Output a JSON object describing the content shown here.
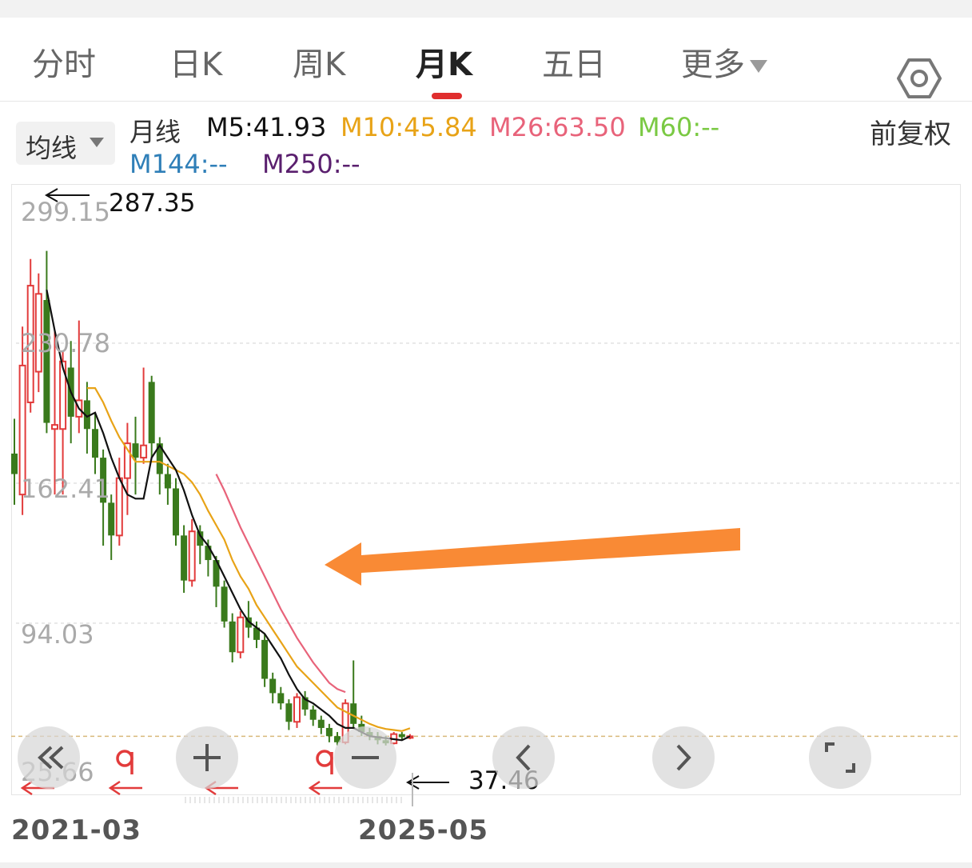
{
  "tabs": [
    {
      "label": "分时"
    },
    {
      "label": "日K"
    },
    {
      "label": "周K"
    },
    {
      "label": "月K"
    },
    {
      "label": "五日"
    },
    {
      "label": "更多"
    }
  ],
  "active_tab": "月K",
  "settings_icon": "hexagon-gear-icon",
  "ma_selector": {
    "label": "均线"
  },
  "legend": {
    "period": "月线",
    "m5": "M5:41.93",
    "m10": "M10:45.84",
    "m26": "M26:63.50",
    "m60": "M60:--",
    "m144": "M144:--",
    "m250": "M250:--"
  },
  "colors": {
    "up": "#e23b3b",
    "down": "#3a7a1c",
    "m5": "#111111",
    "m10": "#e8a317",
    "m26": "#e8637a",
    "m60": "#7ac943",
    "m144": "#2f7fb8",
    "m250": "#5a1f6e",
    "arrow": "#f98a35"
  },
  "adjust_label": "前复权",
  "y_axis_labels": [
    "299.15",
    "230.78",
    "162.41",
    "94.03",
    "25.66"
  ],
  "annotations": {
    "high": "287.35",
    "low": "37.46"
  },
  "date_labels": {
    "start": "2021-03",
    "end": "2025-05"
  },
  "overlay_controls": [
    {
      "name": "scroll-start-icon"
    },
    {
      "name": "zoom-in-icon"
    },
    {
      "name": "zoom-out-icon"
    },
    {
      "name": "previous-icon"
    },
    {
      "name": "next-icon"
    },
    {
      "name": "fullscreen-icon"
    }
  ],
  "chart_data": {
    "type": "candlestick",
    "period": "monthly",
    "x_range": [
      "2021-03",
      "2025-05"
    ],
    "ylim": [
      25.66,
      299.15
    ],
    "y_ticks": [
      299.15,
      230.78,
      162.41,
      94.03,
      25.66
    ],
    "grid": true,
    "high_marker": 287.35,
    "low_marker": 37.46,
    "candles": [
      {
        "o": 180,
        "c": 170,
        "h": 197,
        "l": 155,
        "dir": "down"
      },
      {
        "o": 160,
        "c": 223,
        "h": 242,
        "l": 150,
        "dir": "up"
      },
      {
        "o": 205,
        "c": 262,
        "h": 275,
        "l": 200,
        "dir": "up"
      },
      {
        "o": 220,
        "c": 258,
        "h": 268,
        "l": 210,
        "dir": "up"
      },
      {
        "o": 255,
        "c": 195,
        "h": 279,
        "l": 190,
        "dir": "down"
      },
      {
        "o": 194,
        "c": 192,
        "h": 240,
        "l": 160,
        "dir": "up"
      },
      {
        "o": 192,
        "c": 225,
        "h": 230,
        "l": 160,
        "dir": "up"
      },
      {
        "o": 222,
        "c": 198,
        "h": 235,
        "l": 185,
        "dir": "down"
      },
      {
        "o": 198,
        "c": 206,
        "h": 245,
        "l": 190,
        "dir": "up"
      },
      {
        "o": 206,
        "c": 192,
        "h": 215,
        "l": 180,
        "dir": "down"
      },
      {
        "o": 192,
        "c": 178,
        "h": 200,
        "l": 170,
        "dir": "down"
      },
      {
        "o": 178,
        "c": 156,
        "h": 182,
        "l": 135,
        "dir": "down"
      },
      {
        "o": 156,
        "c": 140,
        "h": 160,
        "l": 128,
        "dir": "down"
      },
      {
        "o": 140,
        "c": 168,
        "h": 178,
        "l": 135,
        "dir": "up"
      },
      {
        "o": 168,
        "c": 185,
        "h": 195,
        "l": 150,
        "dir": "up"
      },
      {
        "o": 185,
        "c": 178,
        "h": 198,
        "l": 160,
        "dir": "down"
      },
      {
        "o": 178,
        "c": 184,
        "h": 222,
        "l": 175,
        "dir": "up"
      },
      {
        "o": 215,
        "c": 185,
        "h": 218,
        "l": 178,
        "dir": "down"
      },
      {
        "o": 185,
        "c": 170,
        "h": 188,
        "l": 160,
        "dir": "down"
      },
      {
        "o": 170,
        "c": 163,
        "h": 175,
        "l": 155,
        "dir": "down"
      },
      {
        "o": 163,
        "c": 140,
        "h": 168,
        "l": 135,
        "dir": "down"
      },
      {
        "o": 140,
        "c": 118,
        "h": 145,
        "l": 112,
        "dir": "down"
      },
      {
        "o": 118,
        "c": 142,
        "h": 148,
        "l": 115,
        "dir": "up"
      },
      {
        "o": 142,
        "c": 135,
        "h": 145,
        "l": 126,
        "dir": "down"
      },
      {
        "o": 135,
        "c": 128,
        "h": 138,
        "l": 120,
        "dir": "down"
      },
      {
        "o": 128,
        "c": 115,
        "h": 130,
        "l": 105,
        "dir": "down"
      },
      {
        "o": 115,
        "c": 98,
        "h": 118,
        "l": 95,
        "dir": "down"
      },
      {
        "o": 98,
        "c": 83,
        "h": 102,
        "l": 78,
        "dir": "down"
      },
      {
        "o": 83,
        "c": 100,
        "h": 103,
        "l": 80,
        "dir": "up"
      },
      {
        "o": 100,
        "c": 95,
        "h": 108,
        "l": 90,
        "dir": "down"
      },
      {
        "o": 95,
        "c": 89,
        "h": 98,
        "l": 85,
        "dir": "down"
      },
      {
        "o": 89,
        "c": 70,
        "h": 92,
        "l": 66,
        "dir": "down"
      },
      {
        "o": 70,
        "c": 63,
        "h": 73,
        "l": 58,
        "dir": "down"
      },
      {
        "o": 63,
        "c": 58,
        "h": 66,
        "l": 55,
        "dir": "down"
      },
      {
        "o": 58,
        "c": 49,
        "h": 60,
        "l": 45,
        "dir": "down"
      },
      {
        "o": 49,
        "c": 61,
        "h": 63,
        "l": 46,
        "dir": "up"
      },
      {
        "o": 61,
        "c": 55,
        "h": 64,
        "l": 52,
        "dir": "down"
      },
      {
        "o": 55,
        "c": 50,
        "h": 57,
        "l": 47,
        "dir": "down"
      },
      {
        "o": 50,
        "c": 46,
        "h": 52,
        "l": 43,
        "dir": "down"
      },
      {
        "o": 46,
        "c": 42,
        "h": 48,
        "l": 39,
        "dir": "down"
      },
      {
        "o": 42,
        "c": 39,
        "h": 44,
        "l": 37.5,
        "dir": "down"
      },
      {
        "o": 39,
        "c": 58,
        "h": 60,
        "l": 38,
        "dir": "up"
      },
      {
        "o": 58,
        "c": 48,
        "h": 79,
        "l": 46,
        "dir": "down"
      },
      {
        "o": 48,
        "c": 44,
        "h": 52,
        "l": 42,
        "dir": "down"
      },
      {
        "o": 44,
        "c": 42,
        "h": 46,
        "l": 40,
        "dir": "down"
      },
      {
        "o": 42,
        "c": 40,
        "h": 44,
        "l": 38,
        "dir": "down"
      },
      {
        "o": 40,
        "c": 38.5,
        "h": 42,
        "l": 37.46,
        "dir": "down"
      },
      {
        "o": 38.5,
        "c": 43,
        "h": 44,
        "l": 38,
        "dir": "up"
      },
      {
        "o": 43,
        "c": 41.5,
        "h": 44,
        "l": 40,
        "dir": "down"
      },
      {
        "o": 41.5,
        "c": 41.93,
        "h": 43,
        "l": 40.5,
        "dir": "up"
      }
    ],
    "m5": [
      null,
      null,
      null,
      null,
      260,
      240,
      222,
      210,
      202,
      198,
      200,
      190,
      178,
      168,
      160,
      158,
      158,
      178,
      184,
      178,
      172,
      162,
      150,
      140,
      135,
      128,
      120,
      112,
      104,
      98,
      95,
      92,
      86,
      80,
      72,
      65,
      60,
      58,
      55,
      52,
      48,
      46,
      46,
      44,
      42,
      41.5,
      41,
      40.5,
      40,
      41.93
    ],
    "m10": [
      null,
      null,
      null,
      null,
      null,
      null,
      null,
      null,
      null,
      212,
      212,
      205,
      196,
      188,
      182,
      176,
      176,
      176,
      176,
      174,
      172,
      170,
      166,
      160,
      152,
      145,
      138,
      128,
      120,
      114,
      106,
      100,
      94,
      88,
      82,
      76,
      72,
      68,
      64,
      60,
      56,
      54,
      52,
      50,
      48,
      46.5,
      45.5,
      45,
      44.5,
      45.84
    ],
    "m26": [
      null,
      null,
      null,
      null,
      null,
      null,
      null,
      null,
      null,
      null,
      null,
      null,
      null,
      null,
      null,
      null,
      null,
      null,
      null,
      null,
      null,
      null,
      null,
      null,
      null,
      170,
      162,
      153,
      144,
      136,
      128,
      120,
      112,
      104,
      97,
      90,
      84,
      78,
      73,
      68,
      65,
      63.5
    ],
    "series": [
      {
        "name": "M5",
        "value": 41.93
      },
      {
        "name": "M10",
        "value": 45.84
      },
      {
        "name": "M26",
        "value": 63.5
      },
      {
        "name": "M60",
        "value": null
      },
      {
        "name": "M144",
        "value": null
      },
      {
        "name": "M250",
        "value": null
      }
    ]
  }
}
